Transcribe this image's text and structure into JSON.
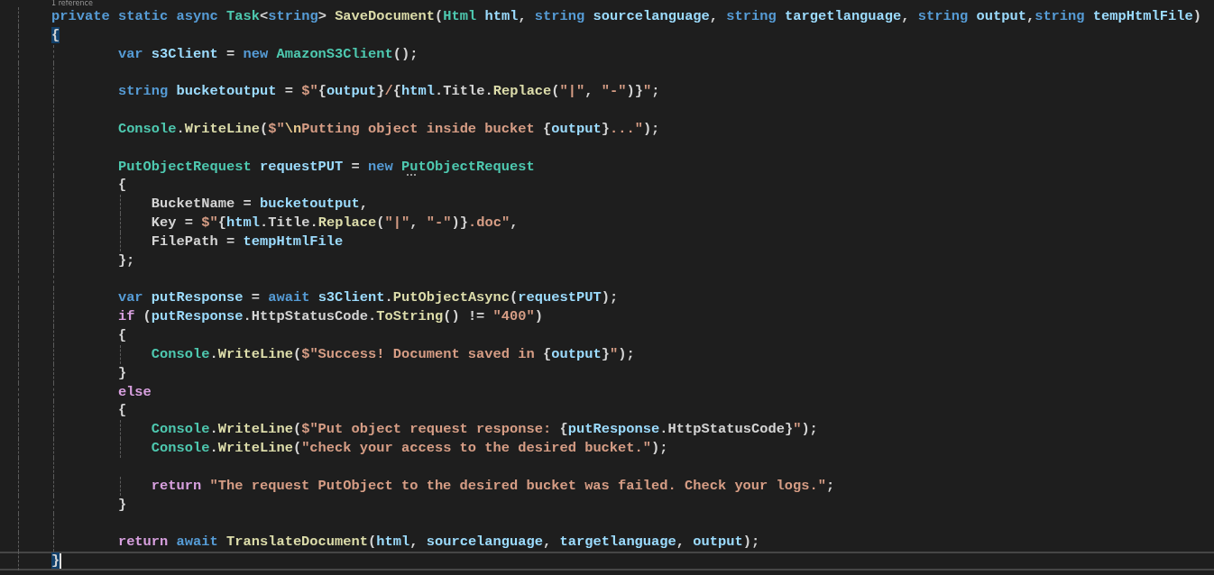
{
  "codelens": "1 reference",
  "current_line_highlight": true,
  "brace_match": true,
  "groups": [
    [
      {
        "code": "private static async Task<string> SaveDocument(Html html, string sourcelanguage, string targetlanguage, string output,string tempHtmlFile)"
      },
      {
        "code": "{"
      },
      {
        "code": "        var s3Client = new AmazonS3Client();"
      }
    ],
    [
      {
        "code": "        string bucketoutput = $\"{output}/{html.Title.Replace(\"|\", \"-\")}\";"
      }
    ],
    [
      {
        "code": "        Console.WriteLine($\"\\nPutting object inside bucket {output}...\");"
      }
    ],
    [
      {
        "code": "        PutObjectRequest requestPUT = new ",
        "hinted": "PutObjectRequest"
      },
      {
        "code": "        {"
      },
      {
        "code": "            BucketName = bucketoutput,"
      },
      {
        "code": "            Key = $\"{html.Title.Replace(\"|\", \"-\")}.doc\","
      },
      {
        "code": "            FilePath = tempHtmlFile"
      },
      {
        "code": "        };"
      }
    ],
    [
      {
        "code": "        var putResponse = await s3Client.PutObjectAsync(requestPUT);"
      },
      {
        "code": "        if (putResponse.HttpStatusCode.ToString() != \"400\")"
      },
      {
        "code": "        {"
      },
      {
        "code": "            Console.WriteLine($\"Success! Document saved in {output}\");"
      },
      {
        "code": "        }"
      },
      {
        "code": "        else"
      },
      {
        "code": "        {"
      },
      {
        "code": "            Console.WriteLine($\"Put object request response: {putResponse.HttpStatusCode}\");"
      },
      {
        "code": "            Console.WriteLine(\"check your access to the desired bucket.\");"
      }
    ],
    [
      {
        "code": "            return \"The request PutObject to the desired bucket was failed. Check your logs.\";"
      },
      {
        "code": "        }"
      }
    ],
    [
      {
        "code": "        return await TranslateDocument(html, sourcelanguage, targetlanguage, output);"
      },
      {
        "code": "}"
      }
    ]
  ]
}
